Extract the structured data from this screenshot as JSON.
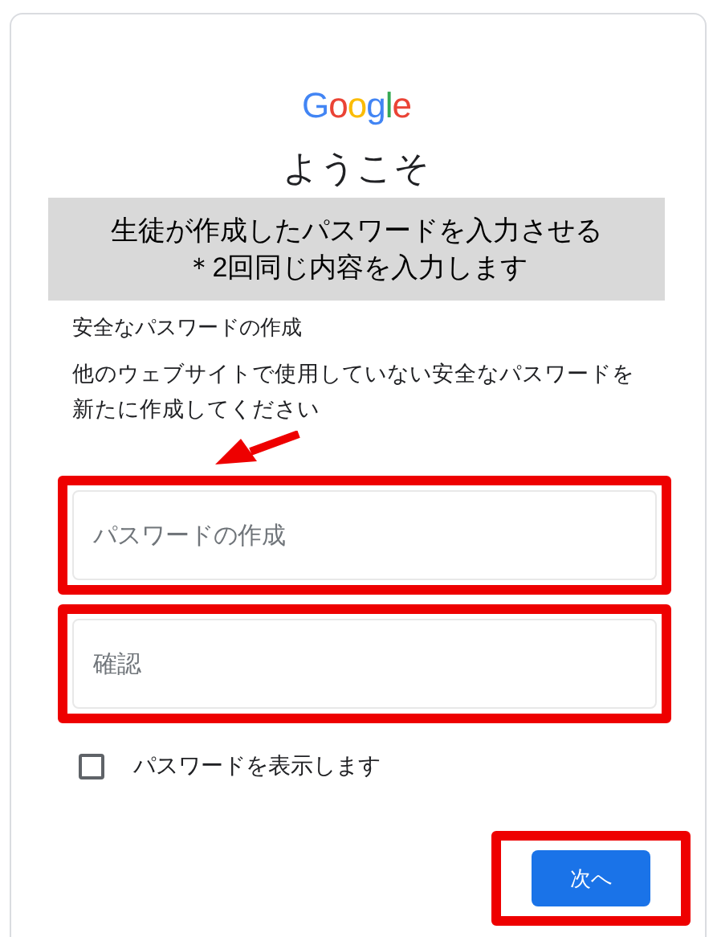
{
  "logo": {
    "text": "Google"
  },
  "title": "ようこそ",
  "annotation": {
    "lines": [
      "生徒が作成したパスワードを入力させる",
      "＊2回同じ内容を入力します"
    ]
  },
  "heading": "安全なパスワードの作成",
  "description": "他のウェブサイトで使用していない安全なパスワードを新たに作成してください",
  "fields": [
    {
      "placeholder": "パスワードの作成",
      "highlighted": true
    },
    {
      "placeholder": "確認",
      "highlighted": true
    }
  ],
  "show_password": {
    "label": "パスワードを表示します",
    "checked": false
  },
  "next_button": {
    "label": "次へ",
    "highlighted": true
  }
}
